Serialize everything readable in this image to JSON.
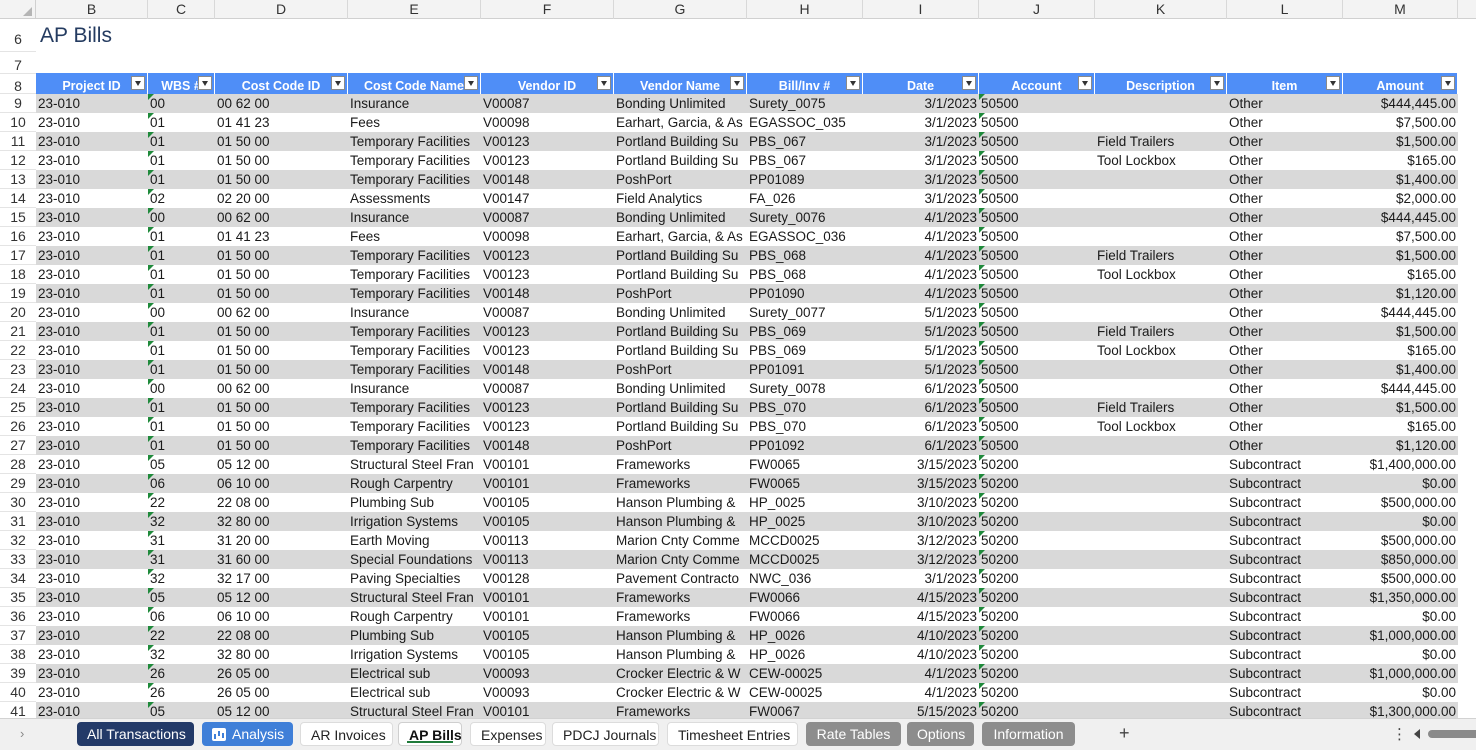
{
  "sheet_title": "AP Bills",
  "columns": [
    "B",
    "C",
    "D",
    "E",
    "F",
    "G",
    "H",
    "I",
    "J",
    "K",
    "L",
    "M"
  ],
  "row_numbers": [
    "6",
    "7",
    "8",
    "9",
    "10",
    "11",
    "12",
    "13",
    "14",
    "15",
    "16",
    "17",
    "18",
    "19",
    "20",
    "21",
    "22",
    "23",
    "24",
    "25",
    "26",
    "27",
    "28",
    "29",
    "30",
    "31",
    "32",
    "33",
    "34",
    "35",
    "36",
    "37",
    "38",
    "39",
    "40",
    "41"
  ],
  "headers": [
    "Project ID",
    "WBS #",
    "Cost Code ID",
    "Cost Code Name",
    "Vendor ID",
    "Vendor Name",
    "Bill/Inv #",
    "Date",
    "Account",
    "Description",
    "Item",
    "Amount"
  ],
  "rows": [
    [
      "23-010",
      "00",
      "00 62 00",
      "Insurance",
      "V00087",
      "Bonding Unlimited",
      "Surety_0075",
      "3/1/2023",
      "50500",
      "",
      "Other",
      "$444,445.00"
    ],
    [
      "23-010",
      "01",
      "01 41 23",
      "Fees",
      "V00098",
      "Earhart, Garcia, & As",
      "EGASSOC_035",
      "3/1/2023",
      "50500",
      "",
      "Other",
      "$7,500.00"
    ],
    [
      "23-010",
      "01",
      "01 50 00",
      "Temporary Facilities",
      "V00123",
      "Portland Building Su",
      "PBS_067",
      "3/1/2023",
      "50500",
      "Field Trailers",
      "Other",
      "$1,500.00"
    ],
    [
      "23-010",
      "01",
      "01 50 00",
      "Temporary Facilities",
      "V00123",
      "Portland Building Su",
      "PBS_067",
      "3/1/2023",
      "50500",
      "Tool Lockbox",
      "Other",
      "$165.00"
    ],
    [
      "23-010",
      "01",
      "01 50 00",
      "Temporary Facilities",
      "V00148",
      "PoshPort",
      "PP01089",
      "3/1/2023",
      "50500",
      "",
      "Other",
      "$1,400.00"
    ],
    [
      "23-010",
      "02",
      "02 20 00",
      "Assessments",
      "V00147",
      "Field Analytics",
      "FA_026",
      "3/1/2023",
      "50500",
      "",
      "Other",
      "$2,000.00"
    ],
    [
      "23-010",
      "00",
      "00 62 00",
      "Insurance",
      "V00087",
      "Bonding Unlimited",
      "Surety_0076",
      "4/1/2023",
      "50500",
      "",
      "Other",
      "$444,445.00"
    ],
    [
      "23-010",
      "01",
      "01 41 23",
      "Fees",
      "V00098",
      "Earhart, Garcia, & As",
      "EGASSOC_036",
      "4/1/2023",
      "50500",
      "",
      "Other",
      "$7,500.00"
    ],
    [
      "23-010",
      "01",
      "01 50 00",
      "Temporary Facilities",
      "V00123",
      "Portland Building Su",
      "PBS_068",
      "4/1/2023",
      "50500",
      "Field Trailers",
      "Other",
      "$1,500.00"
    ],
    [
      "23-010",
      "01",
      "01 50 00",
      "Temporary Facilities",
      "V00123",
      "Portland Building Su",
      "PBS_068",
      "4/1/2023",
      "50500",
      "Tool Lockbox",
      "Other",
      "$165.00"
    ],
    [
      "23-010",
      "01",
      "01 50 00",
      "Temporary Facilities",
      "V00148",
      "PoshPort",
      "PP01090",
      "4/1/2023",
      "50500",
      "",
      "Other",
      "$1,120.00"
    ],
    [
      "23-010",
      "00",
      "00 62 00",
      "Insurance",
      "V00087",
      "Bonding Unlimited",
      "Surety_0077",
      "5/1/2023",
      "50500",
      "",
      "Other",
      "$444,445.00"
    ],
    [
      "23-010",
      "01",
      "01 50 00",
      "Temporary Facilities",
      "V00123",
      "Portland Building Su",
      "PBS_069",
      "5/1/2023",
      "50500",
      "Field Trailers",
      "Other",
      "$1,500.00"
    ],
    [
      "23-010",
      "01",
      "01 50 00",
      "Temporary Facilities",
      "V00123",
      "Portland Building Su",
      "PBS_069",
      "5/1/2023",
      "50500",
      "Tool Lockbox",
      "Other",
      "$165.00"
    ],
    [
      "23-010",
      "01",
      "01 50 00",
      "Temporary Facilities",
      "V00148",
      "PoshPort",
      "PP01091",
      "5/1/2023",
      "50500",
      "",
      "Other",
      "$1,400.00"
    ],
    [
      "23-010",
      "00",
      "00 62 00",
      "Insurance",
      "V00087",
      "Bonding Unlimited",
      "Surety_0078",
      "6/1/2023",
      "50500",
      "",
      "Other",
      "$444,445.00"
    ],
    [
      "23-010",
      "01",
      "01 50 00",
      "Temporary Facilities",
      "V00123",
      "Portland Building Su",
      "PBS_070",
      "6/1/2023",
      "50500",
      "Field Trailers",
      "Other",
      "$1,500.00"
    ],
    [
      "23-010",
      "01",
      "01 50 00",
      "Temporary Facilities",
      "V00123",
      "Portland Building Su",
      "PBS_070",
      "6/1/2023",
      "50500",
      "Tool Lockbox",
      "Other",
      "$165.00"
    ],
    [
      "23-010",
      "01",
      "01 50 00",
      "Temporary Facilities",
      "V00148",
      "PoshPort",
      "PP01092",
      "6/1/2023",
      "50500",
      "",
      "Other",
      "$1,120.00"
    ],
    [
      "23-010",
      "05",
      "05 12 00",
      "Structural Steel Fran",
      "V00101",
      "Frameworks",
      "FW0065",
      "3/15/2023",
      "50200",
      "",
      "Subcontract",
      "$1,400,000.00"
    ],
    [
      "23-010",
      "06",
      "06 10 00",
      "Rough Carpentry",
      "V00101",
      "Frameworks",
      "FW0065",
      "3/15/2023",
      "50200",
      "",
      "Subcontract",
      "$0.00"
    ],
    [
      "23-010",
      "22",
      "22 08 00",
      "Plumbing Sub",
      "V00105",
      "Hanson Plumbing &",
      "HP_0025",
      "3/10/2023",
      "50200",
      "",
      "Subcontract",
      "$500,000.00"
    ],
    [
      "23-010",
      "32",
      "32 80 00",
      "Irrigation Systems",
      "V00105",
      "Hanson Plumbing &",
      "HP_0025",
      "3/10/2023",
      "50200",
      "",
      "Subcontract",
      "$0.00"
    ],
    [
      "23-010",
      "31",
      "31 20 00",
      "Earth Moving",
      "V00113",
      "Marion Cnty Comme",
      "MCCD0025",
      "3/12/2023",
      "50200",
      "",
      "Subcontract",
      "$500,000.00"
    ],
    [
      "23-010",
      "31",
      "31 60 00",
      "Special Foundations",
      "V00113",
      "Marion Cnty Comme",
      "MCCD0025",
      "3/12/2023",
      "50200",
      "",
      "Subcontract",
      "$850,000.00"
    ],
    [
      "23-010",
      "32",
      "32 17 00",
      "Paving Specialties",
      "V00128",
      "Pavement Contracto",
      "NWC_036",
      "3/1/2023",
      "50200",
      "",
      "Subcontract",
      "$500,000.00"
    ],
    [
      "23-010",
      "05",
      "05 12 00",
      "Structural Steel Fran",
      "V00101",
      "Frameworks",
      "FW0066",
      "4/15/2023",
      "50200",
      "",
      "Subcontract",
      "$1,350,000.00"
    ],
    [
      "23-010",
      "06",
      "06 10 00",
      "Rough Carpentry",
      "V00101",
      "Frameworks",
      "FW0066",
      "4/15/2023",
      "50200",
      "",
      "Subcontract",
      "$0.00"
    ],
    [
      "23-010",
      "22",
      "22 08 00",
      "Plumbing Sub",
      "V00105",
      "Hanson Plumbing &",
      "HP_0026",
      "4/10/2023",
      "50200",
      "",
      "Subcontract",
      "$1,000,000.00"
    ],
    [
      "23-010",
      "32",
      "32 80 00",
      "Irrigation Systems",
      "V00105",
      "Hanson Plumbing &",
      "HP_0026",
      "4/10/2023",
      "50200",
      "",
      "Subcontract",
      "$0.00"
    ],
    [
      "23-010",
      "26",
      "26 05 00",
      "Electrical sub",
      "V00093",
      "Crocker Electric & W",
      "CEW-00025",
      "4/1/2023",
      "50200",
      "",
      "Subcontract",
      "$1,000,000.00"
    ],
    [
      "23-010",
      "26",
      "26 05 00",
      "Electrical sub",
      "V00093",
      "Crocker Electric & W",
      "CEW-00025",
      "4/1/2023",
      "50200",
      "",
      "Subcontract",
      "$0.00"
    ],
    [
      "23-010",
      "05",
      "05 12 00",
      "Structural Steel Fran",
      "V00101",
      "Frameworks",
      "FW0067",
      "5/15/2023",
      "50200",
      "",
      "Subcontract",
      "$1,300,000.00"
    ]
  ],
  "tabs": [
    {
      "label": "All Transactions",
      "style": "dark"
    },
    {
      "label": "Analysis",
      "style": "blue",
      "icon": "chart-icon"
    },
    {
      "label": "AR Invoices",
      "style": "plain"
    },
    {
      "label": "AP Bills",
      "style": "active"
    },
    {
      "label": "Expenses",
      "style": "plain"
    },
    {
      "label": "PDCJ Journals",
      "style": "plain"
    },
    {
      "label": "Timesheet Entries",
      "style": "plain"
    },
    {
      "label": "Rate Tables",
      "style": "gray"
    },
    {
      "label": "Options",
      "style": "gray"
    },
    {
      "label": "Information",
      "style": "gray"
    }
  ],
  "colors": {
    "header_blue": "#4f8ef7",
    "band_gray": "#d9d9d9",
    "title": "#243b60",
    "tab_dark": "#233a68",
    "tab_blue": "#3f7fd8",
    "tab_gray": "#8d8d8d",
    "error_marker": "#1f8a3b"
  }
}
